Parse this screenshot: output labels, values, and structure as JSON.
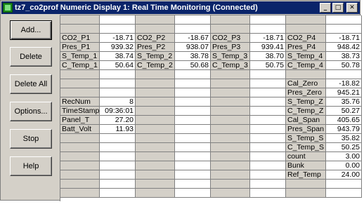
{
  "window": {
    "title": "tz7_co2prof Numeric Display 1: Real Time Monitoring (Connected)"
  },
  "titlebar_buttons": {
    "minimize": "_",
    "maximize": "□",
    "close": "✕"
  },
  "buttons": {
    "add": "Add...",
    "delete": "Delete",
    "delete_all": "Delete All",
    "options": "Options...",
    "stop": "Stop",
    "help": "Help"
  },
  "grid": {
    "col1": [
      {
        "label": "",
        "value": ""
      },
      {
        "label": "",
        "value": ""
      },
      {
        "label": "CO2_P1",
        "value": "-18.71"
      },
      {
        "label": "Pres_P1",
        "value": "939.32"
      },
      {
        "label": "S_Temp_1",
        "value": "38.74"
      },
      {
        "label": "C_Temp_1",
        "value": "50.64"
      },
      {
        "label": "",
        "value": ""
      },
      {
        "label": "",
        "value": ""
      },
      {
        "label": "",
        "value": ""
      },
      {
        "label": "RecNum",
        "value": "8"
      },
      {
        "label": "TimeStamp",
        "value": "09:36:01"
      },
      {
        "label": "Panel_T",
        "value": "27.20"
      },
      {
        "label": "Batt_Volt",
        "value": "11.93"
      },
      {
        "label": "",
        "value": ""
      },
      {
        "label": "",
        "value": ""
      },
      {
        "label": "",
        "value": ""
      },
      {
        "label": "",
        "value": ""
      },
      {
        "label": "",
        "value": ""
      },
      {
        "label": "",
        "value": ""
      },
      {
        "label": "",
        "value": ""
      }
    ],
    "col2": [
      {
        "label": "",
        "value": ""
      },
      {
        "label": "",
        "value": ""
      },
      {
        "label": "CO2_P2",
        "value": "-18.67"
      },
      {
        "label": "Pres_P2",
        "value": "938.07"
      },
      {
        "label": "S_Temp_2",
        "value": "38.78"
      },
      {
        "label": "C_Temp_2",
        "value": "50.68"
      },
      {
        "label": "",
        "value": ""
      },
      {
        "label": "",
        "value": ""
      },
      {
        "label": "",
        "value": ""
      },
      {
        "label": "",
        "value": ""
      },
      {
        "label": "",
        "value": ""
      },
      {
        "label": "",
        "value": ""
      },
      {
        "label": "",
        "value": ""
      },
      {
        "label": "",
        "value": ""
      },
      {
        "label": "",
        "value": ""
      },
      {
        "label": "",
        "value": ""
      },
      {
        "label": "",
        "value": ""
      },
      {
        "label": "",
        "value": ""
      },
      {
        "label": "",
        "value": ""
      },
      {
        "label": "",
        "value": ""
      }
    ],
    "col3": [
      {
        "label": "",
        "value": ""
      },
      {
        "label": "",
        "value": ""
      },
      {
        "label": "CO2_P3",
        "value": "-18.71"
      },
      {
        "label": "Pres_P3",
        "value": "939.41"
      },
      {
        "label": "S_Temp_3",
        "value": "38.70"
      },
      {
        "label": "C_Temp_3",
        "value": "50.75"
      },
      {
        "label": "",
        "value": ""
      },
      {
        "label": "",
        "value": ""
      },
      {
        "label": "",
        "value": ""
      },
      {
        "label": "",
        "value": ""
      },
      {
        "label": "",
        "value": ""
      },
      {
        "label": "",
        "value": ""
      },
      {
        "label": "",
        "value": ""
      },
      {
        "label": "",
        "value": ""
      },
      {
        "label": "",
        "value": ""
      },
      {
        "label": "",
        "value": ""
      },
      {
        "label": "",
        "value": ""
      },
      {
        "label": "",
        "value": ""
      },
      {
        "label": "",
        "value": ""
      },
      {
        "label": "",
        "value": ""
      }
    ],
    "col4": [
      {
        "label": "",
        "value": ""
      },
      {
        "label": "",
        "value": ""
      },
      {
        "label": "CO2_P4",
        "value": "-18.71"
      },
      {
        "label": "Pres_P4",
        "value": "948.42"
      },
      {
        "label": "S_Temp_4",
        "value": "38.73"
      },
      {
        "label": "C_Temp_4",
        "value": "50.78"
      },
      {
        "label": "",
        "value": ""
      },
      {
        "label": "Cal_Zero",
        "value": "-18.82"
      },
      {
        "label": "Pres_Zero",
        "value": "945.21"
      },
      {
        "label": "S_Temp_Z",
        "value": "35.76"
      },
      {
        "label": "C_Temp_Z",
        "value": "50.27"
      },
      {
        "label": "Cal_Span",
        "value": "405.65"
      },
      {
        "label": "Pres_Span",
        "value": "943.79"
      },
      {
        "label": "S_Temp_S",
        "value": "35.82"
      },
      {
        "label": "C_Temp_S",
        "value": "50.25"
      },
      {
        "label": "count",
        "value": "3.00"
      },
      {
        "label": "Bunk",
        "value": "0.00"
      },
      {
        "label": "Ref_Temp",
        "value": "24.00"
      },
      {
        "label": "",
        "value": ""
      },
      {
        "label": "",
        "value": ""
      }
    ]
  }
}
